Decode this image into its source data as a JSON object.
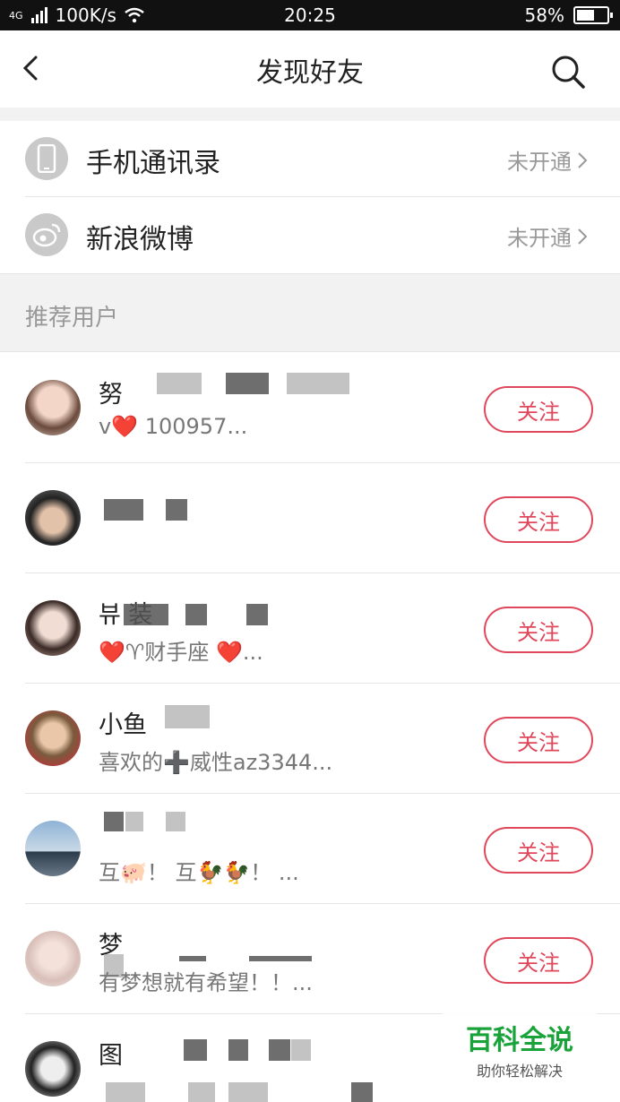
{
  "status": {
    "network": "4G",
    "speed": "100K/s",
    "time": "20:25",
    "battery": "58%",
    "battery_level": 0.58
  },
  "nav": {
    "title": "发现好友",
    "back_icon": "chevron-left-icon",
    "search_icon": "search-icon"
  },
  "entries": [
    {
      "label": "手机通讯录",
      "state": "未开通",
      "icon": "phone-icon"
    },
    {
      "label": "新浪微博",
      "state": "未开通",
      "icon": "weibo-icon"
    }
  ],
  "section": {
    "title": "推荐用户"
  },
  "follow_label": "关注",
  "users": [
    {
      "name": "努",
      "bio": "v❤️ 100957..."
    },
    {
      "name": "",
      "bio": ""
    },
    {
      "name": "뷰 装",
      "bio": "❤️♈财手座 ❤️..."
    },
    {
      "name": "小鱼",
      "bio": "喜欢的➕威性az3344..."
    },
    {
      "name": "",
      "bio": "互🐖！ 互🐓🐓！ ..."
    },
    {
      "name": "梦",
      "bio": "有梦想就有希望！！..."
    },
    {
      "name": "图",
      "bio": ""
    }
  ],
  "watermark": {
    "title": "百科全说",
    "subtitle": "助你轻松解决"
  },
  "colors": {
    "accent": "#e0475a",
    "watermark": "#1aa33a"
  }
}
